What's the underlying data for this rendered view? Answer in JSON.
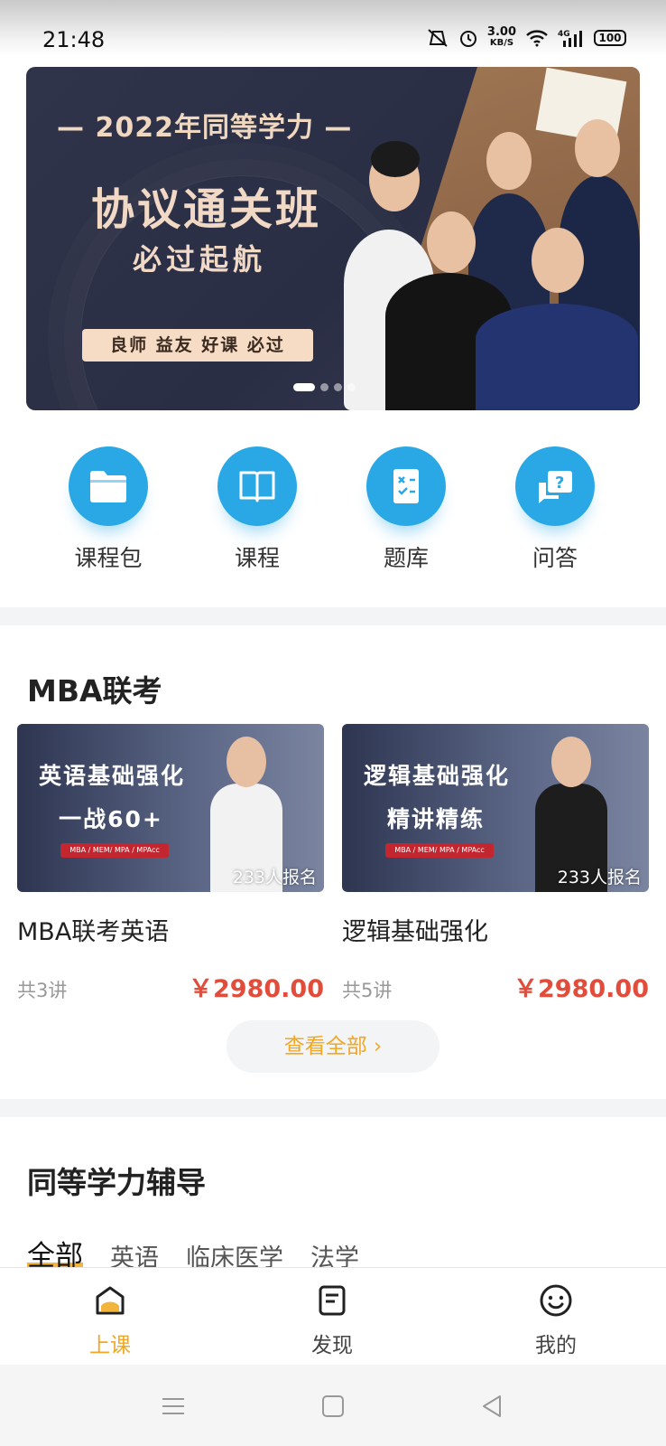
{
  "status_bar": {
    "time": "21:48",
    "speed_value": "3.00",
    "speed_unit": "KB/S",
    "battery": "100",
    "icons": [
      "mute-vibrate-icon",
      "alarm-icon",
      "wifi-icon",
      "signal-4g-icon",
      "battery-icon"
    ]
  },
  "banner": {
    "year_line": "— 2022年同等学力 —",
    "title": "协议通关班",
    "subtitle": "必过起航",
    "pill": "良师  益友  好课  必过",
    "dots": 4,
    "active_dot": 0
  },
  "quick_actions": [
    {
      "label": "课程包",
      "icon": "folder-icon"
    },
    {
      "label": "课程",
      "icon": "book-icon"
    },
    {
      "label": "题库",
      "icon": "question-bank-icon"
    },
    {
      "label": "问答",
      "icon": "qa-icon"
    }
  ],
  "mba_section": {
    "title": "MBA联考",
    "courses": [
      {
        "image_line1": "英语基础强化",
        "image_line2": "一战60+",
        "image_tag": "MBA / MEM/ MPA / MPAcc",
        "enrolled": "233人报名",
        "name": "MBA联考英语",
        "lessons": "共3讲",
        "price": "￥2980.00"
      },
      {
        "image_line1": "逻辑基础强化",
        "image_line2": "精讲精练",
        "image_tag": "MBA / MEM/ MPA / MPAcc",
        "enrolled": "233人报名",
        "name": "逻辑基础强化",
        "lessons": "共5讲",
        "price": "￥2980.00"
      }
    ],
    "view_all": "查看全部 ›"
  },
  "equivalent_section": {
    "title": "同等学力辅导",
    "tabs": [
      "全部",
      "英语",
      "临床医学",
      "法学"
    ],
    "active_tab": 0
  },
  "bottom_nav": {
    "items": [
      {
        "label": "上课",
        "icon": "class-home-icon"
      },
      {
        "label": "发现",
        "icon": "discover-icon"
      },
      {
        "label": "我的",
        "icon": "smile-profile-icon"
      }
    ],
    "active": 0,
    "accent": "#f0a726"
  },
  "colors": {
    "primary_blue": "#2aa8e6",
    "price_red": "#e14d3a",
    "accent_orange": "#f0a726"
  }
}
